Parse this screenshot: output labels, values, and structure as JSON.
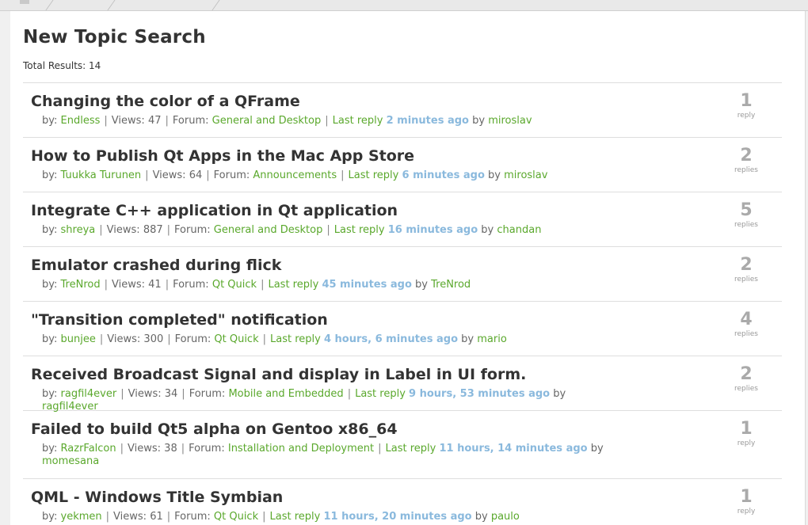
{
  "page": {
    "title": "New Topic Search",
    "total_results": "Total Results: 14"
  },
  "labels": {
    "by": "by:",
    "views": "Views:",
    "forum": "Forum:",
    "last_reply": "Last reply",
    "by_last": "by"
  },
  "topics": [
    {
      "title": "Changing the color of a QFrame",
      "author": "Endless",
      "views": "47",
      "forum": "General and Desktop",
      "ago": "2 minutes ago",
      "last_user": "miroslav",
      "count": "1",
      "count_label": "reply"
    },
    {
      "title": "How to Publish Qt Apps in the Mac App Store",
      "author": "Tuukka Turunen",
      "views": "64",
      "forum": "Announcements",
      "ago": "6 minutes ago",
      "last_user": "miroslav",
      "count": "2",
      "count_label": "replies"
    },
    {
      "title": "Integrate C++ application in Qt application",
      "author": "shreya",
      "views": "887",
      "forum": "General and Desktop",
      "ago": "16 minutes ago",
      "last_user": "chandan",
      "count": "5",
      "count_label": "replies"
    },
    {
      "title": "Emulator crashed during flick",
      "author": "TreNrod",
      "views": "41",
      "forum": "Qt Quick",
      "ago": "45 minutes ago",
      "last_user": "TreNrod",
      "count": "2",
      "count_label": "replies"
    },
    {
      "title": "\"Transition completed\" notification",
      "author": "bunjee",
      "views": "300",
      "forum": "Qt Quick",
      "ago": "4 hours, 6 minutes ago",
      "last_user": "mario",
      "count": "4",
      "count_label": "replies"
    },
    {
      "title": "Received Broadcast Signal and display in Label in UI form.",
      "author": "ragfil4ever",
      "views": "34",
      "forum": "Mobile and Embedded",
      "ago": "9 hours, 53 minutes ago",
      "last_user": "ragfil4ever",
      "count": "2",
      "count_label": "replies"
    },
    {
      "title": "Failed to build Qt5 alpha on Gentoo x86_64",
      "author": "RazrFalcon",
      "views": "38",
      "forum": "Installation and Deployment",
      "ago": "11 hours, 14 minutes ago",
      "last_user": "momesana",
      "count": "1",
      "count_label": "reply"
    },
    {
      "title": "QML - Windows Title Symbian",
      "author": "yekmen",
      "views": "61",
      "forum": "Qt Quick",
      "ago": "11 hours, 20 minutes ago",
      "last_user": "paulo",
      "count": "1",
      "count_label": "reply"
    }
  ]
}
